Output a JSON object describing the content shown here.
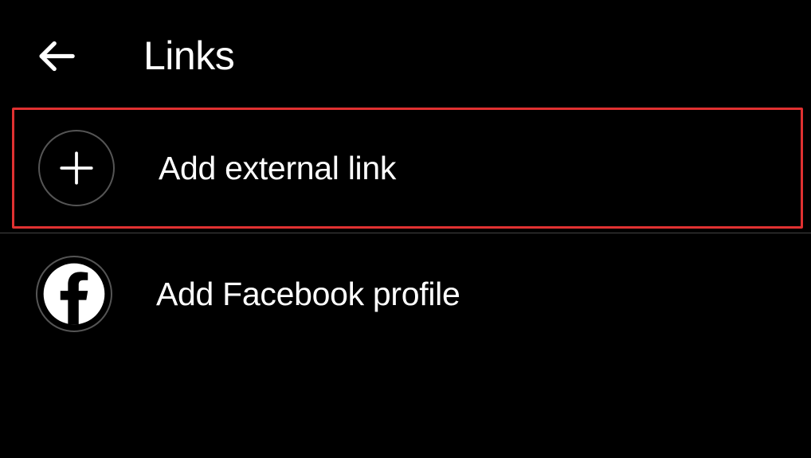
{
  "header": {
    "title": "Links"
  },
  "items": [
    {
      "label": "Add external link",
      "highlighted": true
    },
    {
      "label": "Add Facebook profile",
      "highlighted": false
    }
  ]
}
